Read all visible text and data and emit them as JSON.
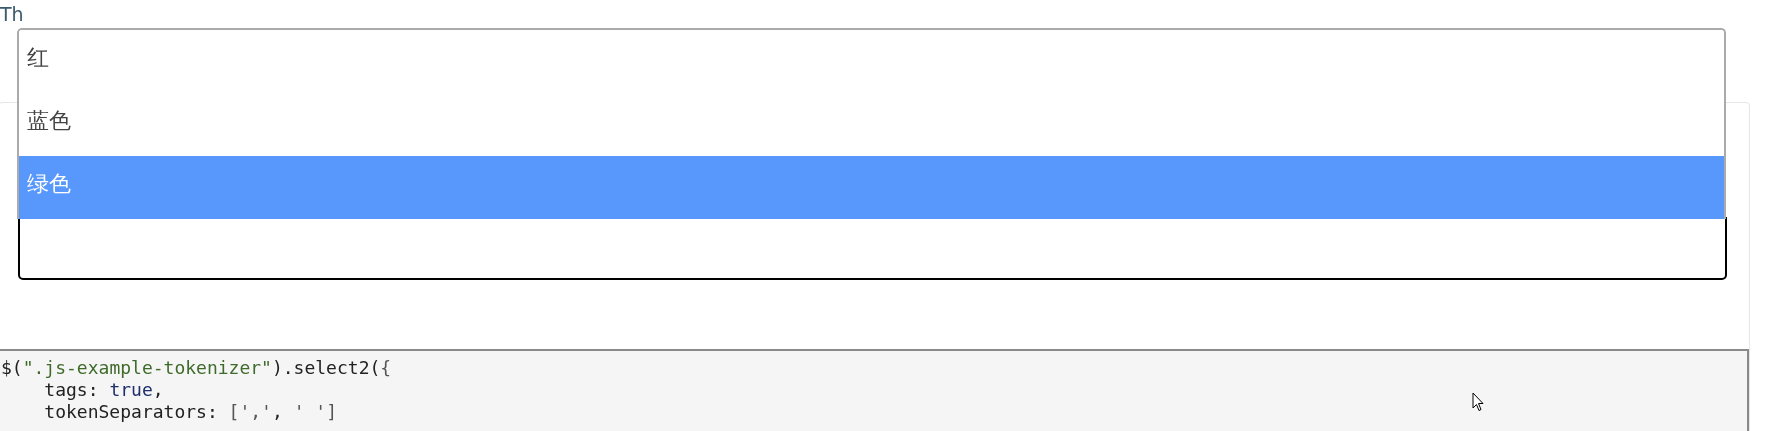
{
  "intro": {
    "text": "Th"
  },
  "dropdown": {
    "options": [
      {
        "label": "红",
        "selected": false
      },
      {
        "label": "蓝色",
        "selected": false
      },
      {
        "label": "绿色",
        "selected": true
      }
    ]
  },
  "select_field": {
    "kind": "select"
  },
  "code_block": {
    "lines": [
      [
        {
          "text": "$(",
          "kind": "plain"
        },
        {
          "text": "\".js-example-tokenizer\"",
          "kind": "string"
        },
        {
          "text": ").select2(",
          "kind": "plain"
        },
        {
          "text": "{",
          "kind": "punct"
        }
      ],
      [
        {
          "text": "    tags: ",
          "kind": "plain"
        },
        {
          "text": "true",
          "kind": "keyword"
        },
        {
          "text": ",",
          "kind": "plain"
        }
      ],
      [
        {
          "text": "    tokenSeparators: ",
          "kind": "plain"
        },
        {
          "text": "[','",
          "kind": "punct"
        },
        {
          "text": ", ",
          "kind": "plain"
        },
        {
          "text": "' ']",
          "kind": "punct"
        }
      ]
    ]
  }
}
